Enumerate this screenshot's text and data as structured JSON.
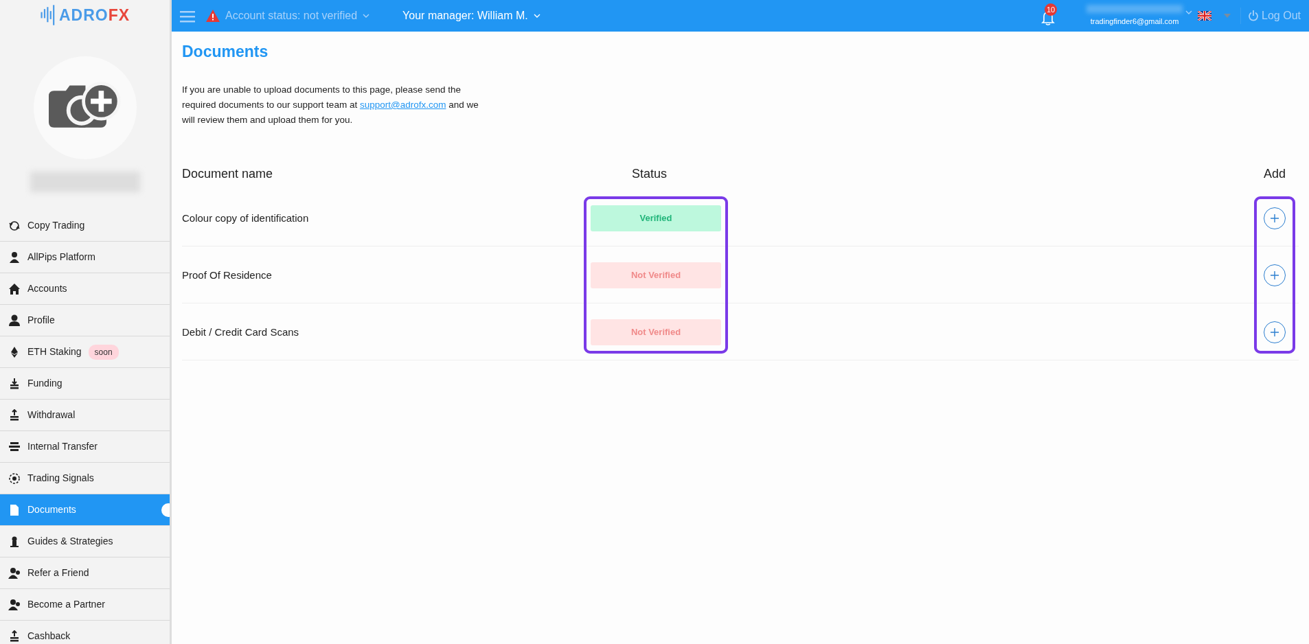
{
  "brand": {
    "part_1": "ADRO",
    "part_2": "FX"
  },
  "topbar": {
    "account_status": "Account status: not verified",
    "manager": "Your manager: William M.",
    "notifications": "10",
    "email": "tradingfinder6@gmail.com",
    "logout": "Log Out"
  },
  "sidebar": {
    "items": [
      {
        "label": "Copy Trading",
        "selected": false
      },
      {
        "label": "AllPips Platform",
        "selected": false
      },
      {
        "label": "Accounts",
        "selected": false
      },
      {
        "label": "Profile",
        "selected": false
      },
      {
        "label": "ETH Staking",
        "selected": false,
        "badge": "soon"
      },
      {
        "label": "Funding",
        "selected": false
      },
      {
        "label": "Withdrawal",
        "selected": false
      },
      {
        "label": "Internal Transfer",
        "selected": false
      },
      {
        "label": "Trading Signals",
        "selected": false
      },
      {
        "label": "Documents",
        "selected": true
      },
      {
        "label": "Guides & Strategies",
        "selected": false
      },
      {
        "label": "Refer a Friend",
        "selected": false
      },
      {
        "label": "Become a Partner",
        "selected": false
      },
      {
        "label": "Cashback",
        "selected": false
      }
    ]
  },
  "page": {
    "title": "Documents",
    "intro_before": "If you are unable to upload documents to this page, please send the required documents to our support team at",
    "intro_link": "support@adrofx.com",
    "intro_after": "and we will review them and upload them for you."
  },
  "table": {
    "columns": [
      {
        "label": "Document name",
        "highlighted": false
      },
      {
        "label": "Status",
        "highlighted": true
      },
      {
        "label": "Add",
        "highlighted": true
      }
    ],
    "rows": [
      {
        "name": "Colour copy of identification",
        "status": "Verified",
        "verified": true
      },
      {
        "name": "Proof Of Residence",
        "status": "Not Verified",
        "verified": false
      },
      {
        "name": "Debit / Credit Card Scans",
        "status": "Not Verified",
        "verified": false
      }
    ]
  }
}
